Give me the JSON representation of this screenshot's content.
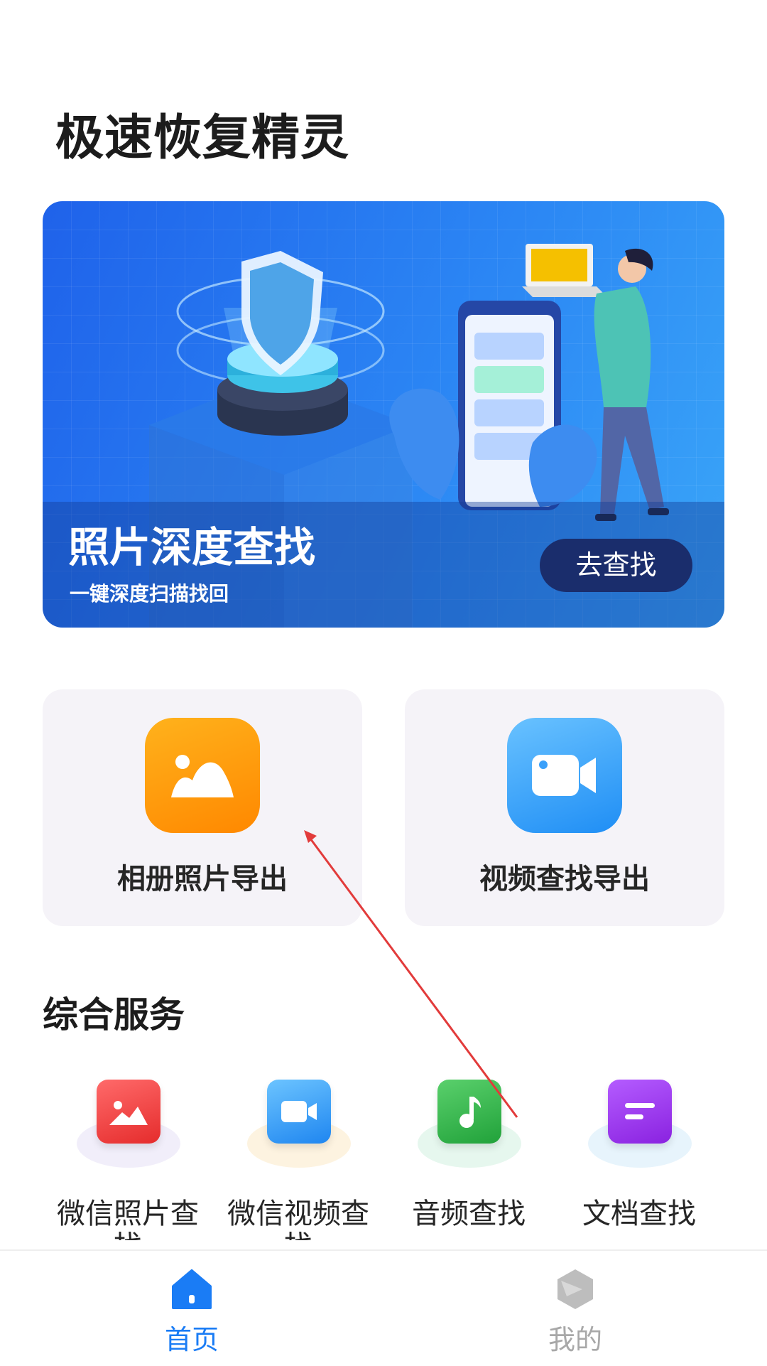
{
  "app": {
    "title": "极速恢复精灵"
  },
  "banner": {
    "title": "照片深度查找",
    "subtitle": "一键深度扫描找回",
    "button_label": "去查找"
  },
  "features": [
    {
      "label": "相册照片导出",
      "icon": "photo-icon",
      "color": "#ff9a0c"
    },
    {
      "label": "视频查找导出",
      "icon": "video-camera-icon",
      "color": "#3aa0fa"
    }
  ],
  "services": {
    "section_title": "综合服务",
    "items": [
      {
        "label": "微信照片查",
        "label_overflow": "找",
        "icon": "image-icon",
        "color": "#ef3e3e",
        "halo": "#f1eefa"
      },
      {
        "label": "微信视频查",
        "label_overflow": "找",
        "icon": "video-icon",
        "color": "#2f95f6",
        "halo": "#fdf3e0"
      },
      {
        "label": "音频查找",
        "label_overflow": "",
        "icon": "music-note-icon",
        "color": "#35b24a",
        "halo": "#e6f7ee"
      },
      {
        "label": "文档查找",
        "label_overflow": "",
        "icon": "document-icon",
        "color": "#9a33e8",
        "halo": "#e7f4fc"
      }
    ]
  },
  "nav": {
    "home_label": "首页",
    "mine_label": "我的",
    "active": "home",
    "active_color": "#1a7cf5",
    "inactive_color": "#a8a8a8"
  }
}
